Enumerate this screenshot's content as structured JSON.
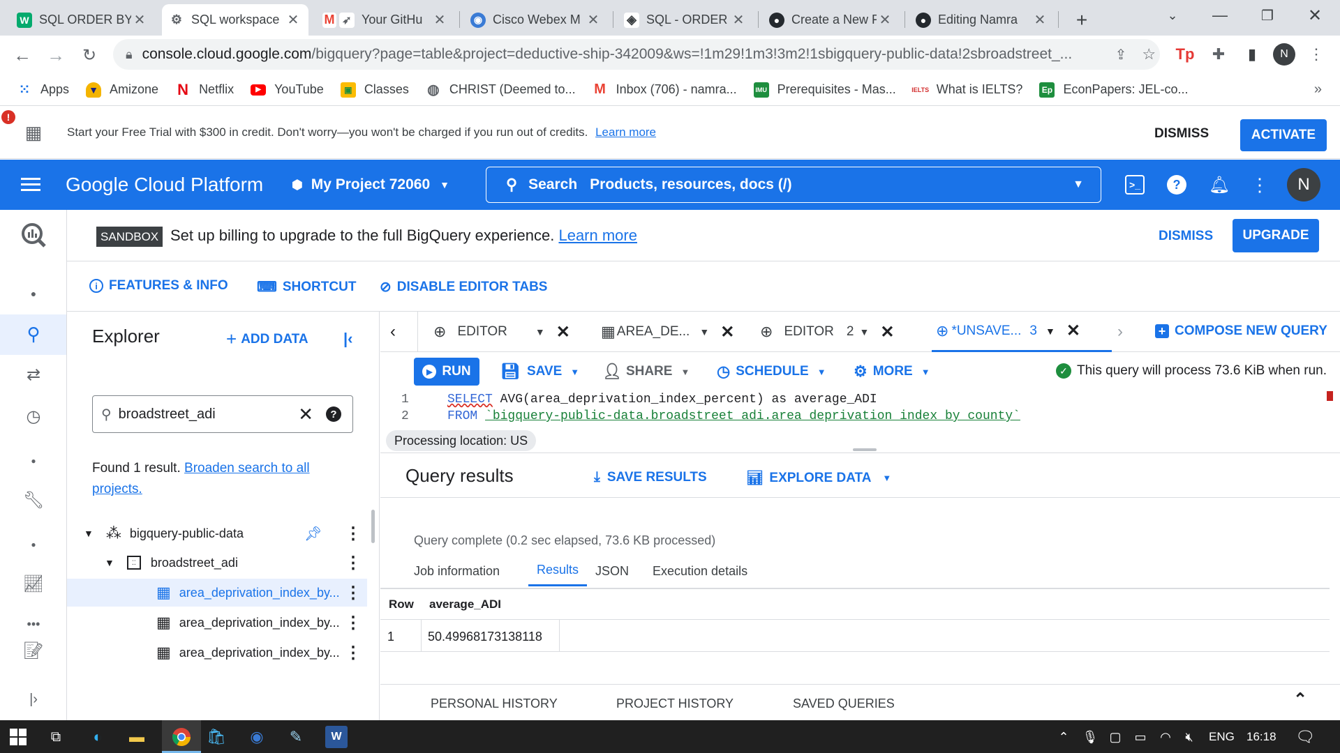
{
  "browser": {
    "tabs": [
      {
        "title": "SQL ORDER BY",
        "icon": "w3schools-icon",
        "color": "#04aa6d",
        "glyph": "W"
      },
      {
        "title": "SQL workspace",
        "icon": "google-cloud-icon",
        "color": "#5f6368",
        "glyph": "⚙"
      },
      {
        "title": "Your GitHu",
        "icon": "gmail-icon",
        "color": "#ea4335",
        "glyph": "M"
      },
      {
        "title": "Cisco Webex M",
        "icon": "webex-icon",
        "color": "#3a7bd5",
        "glyph": "◉"
      },
      {
        "title": "SQL - ORDER E",
        "icon": "tutorial-icon",
        "color": "#5f6368",
        "glyph": "◈"
      },
      {
        "title": "Create a New F",
        "icon": "github-icon",
        "color": "#24292e",
        "glyph": "●"
      },
      {
        "title": "Editing Namra",
        "icon": "github-icon",
        "color": "#24292e",
        "glyph": "●"
      }
    ],
    "new_tab": "+",
    "url_host": "console.cloud.google.com",
    "url_path": "/bigquery?page=table&project=deductive-ship-342009&ws=!1m29!1m3!3m2!1sbigquery-public-data!2sbroadstreet_...",
    "profile_initial": "N",
    "bookmarks": [
      {
        "label": "Apps",
        "icon": "apps-grid-icon"
      },
      {
        "label": "Amizone",
        "icon": "amizone-icon"
      },
      {
        "label": "Netflix",
        "icon": "netflix-icon"
      },
      {
        "label": "YouTube",
        "icon": "youtube-icon"
      },
      {
        "label": "Classes",
        "icon": "classes-icon"
      },
      {
        "label": "CHRIST (Deemed to...",
        "icon": "globe-icon"
      },
      {
        "label": "Inbox (706) - namra...",
        "icon": "gmail-icon"
      },
      {
        "label": "Prerequisites - Mas...",
        "icon": "imu-icon"
      },
      {
        "label": "What is IELTS?",
        "icon": "ielts-icon"
      },
      {
        "label": "EconPapers: JEL-co...",
        "icon": "econpapers-icon"
      }
    ],
    "bookmarks_overflow": "»"
  },
  "trial_banner": {
    "text": "Start your Free Trial with $300 in credit. Don't worry—you won't be charged if you run out of credits.",
    "link": "Learn more",
    "dismiss": "DISMISS",
    "activate": "ACTIVATE"
  },
  "gcp_header": {
    "logo": "Google Cloud Platform",
    "project": "My Project 72060",
    "search_label": "Search",
    "search_placeholder": "Products, resources, docs (/)",
    "avatar": "N"
  },
  "sandbox_banner": {
    "badge": "SANDBOX",
    "text": "Set up billing to upgrade to the full BigQuery experience.",
    "link": "Learn more",
    "dismiss": "DISMISS",
    "upgrade": "UPGRADE"
  },
  "toolbar": {
    "features": "FEATURES & INFO",
    "shortcut": "SHORTCUT",
    "disable_tabs": "DISABLE EDITOR TABS"
  },
  "explorer": {
    "title": "Explorer",
    "add_data": "ADD DATA",
    "search_value": "broadstreet_adi",
    "found_text": "Found 1 result.",
    "broaden_link_1": "Broaden search to all",
    "broaden_link_2": "projects.",
    "project": "bigquery-public-data",
    "dataset": "broadstreet_adi",
    "tables": [
      "area_deprivation_index_by...",
      "area_deprivation_index_by...",
      "area_deprivation_index_by..."
    ]
  },
  "editor_tabs": [
    {
      "label": "EDITOR",
      "suffix": ""
    },
    {
      "label": "AREA_DE...",
      "suffix": ""
    },
    {
      "label": "EDITOR",
      "suffix": "2"
    },
    {
      "label": "*UNSAVE...",
      "suffix": "3"
    }
  ],
  "compose": "COMPOSE NEW QUERY",
  "actions": {
    "run": "RUN",
    "save": "SAVE",
    "share": "SHARE",
    "schedule": "SCHEDULE",
    "more": "MORE",
    "process_info": "This query will process 73.6 KiB when run."
  },
  "code": {
    "line1_num": "1",
    "line2_num": "2",
    "line1_kw": "SELECT",
    "line1_rest": " AVG(area_deprivation_index_percent) as average_ADI",
    "line2_kw": "FROM",
    "line2_table": "`bigquery-public-data.broadstreet_adi.area_deprivation_index_by_county`"
  },
  "processing_location": "Processing location: US",
  "results": {
    "title": "Query results",
    "save_results": "SAVE RESULTS",
    "explore_data": "EXPLORE DATA",
    "status": "Query complete (0.2 sec elapsed, 73.6 KB processed)",
    "tabs": [
      "Job information",
      "Results",
      "JSON",
      "Execution details"
    ],
    "columns": [
      "Row",
      "average_ADI"
    ],
    "rows": [
      [
        "1",
        "50.49968173138118"
      ]
    ]
  },
  "history_tabs": [
    "PERSONAL HISTORY",
    "PROJECT HISTORY",
    "SAVED QUERIES"
  ],
  "taskbar": {
    "lang": "ENG",
    "time": "16:18"
  }
}
